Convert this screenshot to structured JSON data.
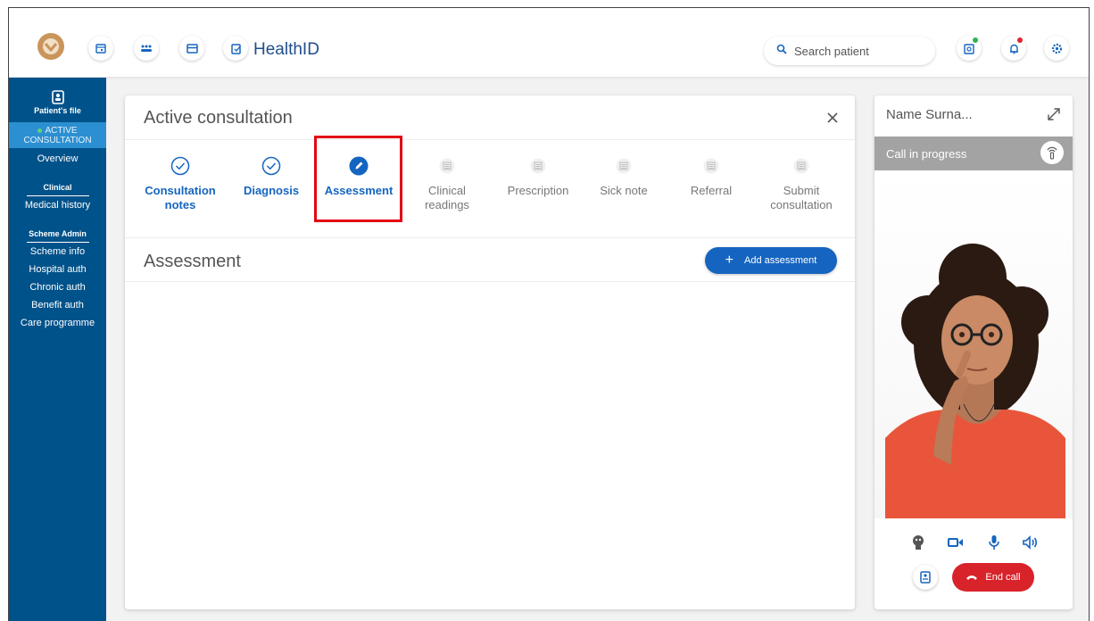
{
  "header": {
    "app_title": "HealthID",
    "search_placeholder": "Search patient"
  },
  "sidebar": {
    "file_label": "Patient's file",
    "active_label": "ACTIVE CONSULTATION",
    "overview": "Overview",
    "clinical_heading": "Clinical",
    "clinical_items": [
      "Medical history"
    ],
    "scheme_heading": "Scheme Admin",
    "scheme_items": [
      "Scheme info",
      "Hospital auth",
      "Chronic auth",
      "Benefit auth",
      "Care programme"
    ]
  },
  "consultation": {
    "title": "Active consultation",
    "steps": [
      {
        "line1": "Consultation",
        "line2": "notes",
        "state": "done"
      },
      {
        "line1": "Diagnosis",
        "line2": "",
        "state": "done"
      },
      {
        "line1": "Assessment",
        "line2": "",
        "state": "current"
      },
      {
        "line1": "Clinical",
        "line2": "readings",
        "state": "pending"
      },
      {
        "line1": "Prescription",
        "line2": "",
        "state": "pending"
      },
      {
        "line1": "Sick note",
        "line2": "",
        "state": "pending"
      },
      {
        "line1": "Referral",
        "line2": "",
        "state": "pending"
      },
      {
        "line1": "Submit",
        "line2": "consultation",
        "state": "pending"
      }
    ],
    "section_title": "Assessment",
    "add_button": "Add assessment"
  },
  "call": {
    "name": "Name Surna...",
    "status": "Call in progress",
    "end_call": "End call"
  },
  "colors": {
    "brand_blue": "#1565c0",
    "sidebar_blue": "#00528a",
    "end_call_red": "#d8232a",
    "highlight_red": "#e30613"
  }
}
